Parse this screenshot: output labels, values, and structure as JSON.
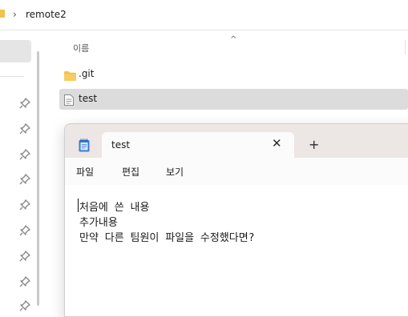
{
  "explorer": {
    "breadcrumb": {
      "separator": "›",
      "current_folder": "remote2"
    },
    "column_header": {
      "name_label": "이름",
      "sort_indicator": "^"
    },
    "files": [
      {
        "name": ".git",
        "icon": "folder-icon",
        "selected": false
      },
      {
        "name": "test",
        "icon": "text-file-icon",
        "selected": true
      }
    ]
  },
  "notepad": {
    "tab_title": "test",
    "close_glyph": "✕",
    "new_tab_glyph": "+",
    "menu": [
      "파일",
      "편집",
      "보기"
    ],
    "lines": [
      "처음에 쓴 내용",
      "추가내용",
      "만약 다른 팀원이 파일을 수정했다면?"
    ]
  },
  "colors": {
    "folder": "#f2c14e",
    "selection": "#dcdcdc",
    "notepad_titlebar": "#ece6e4",
    "notepad_icon": "#3a7bd5"
  }
}
